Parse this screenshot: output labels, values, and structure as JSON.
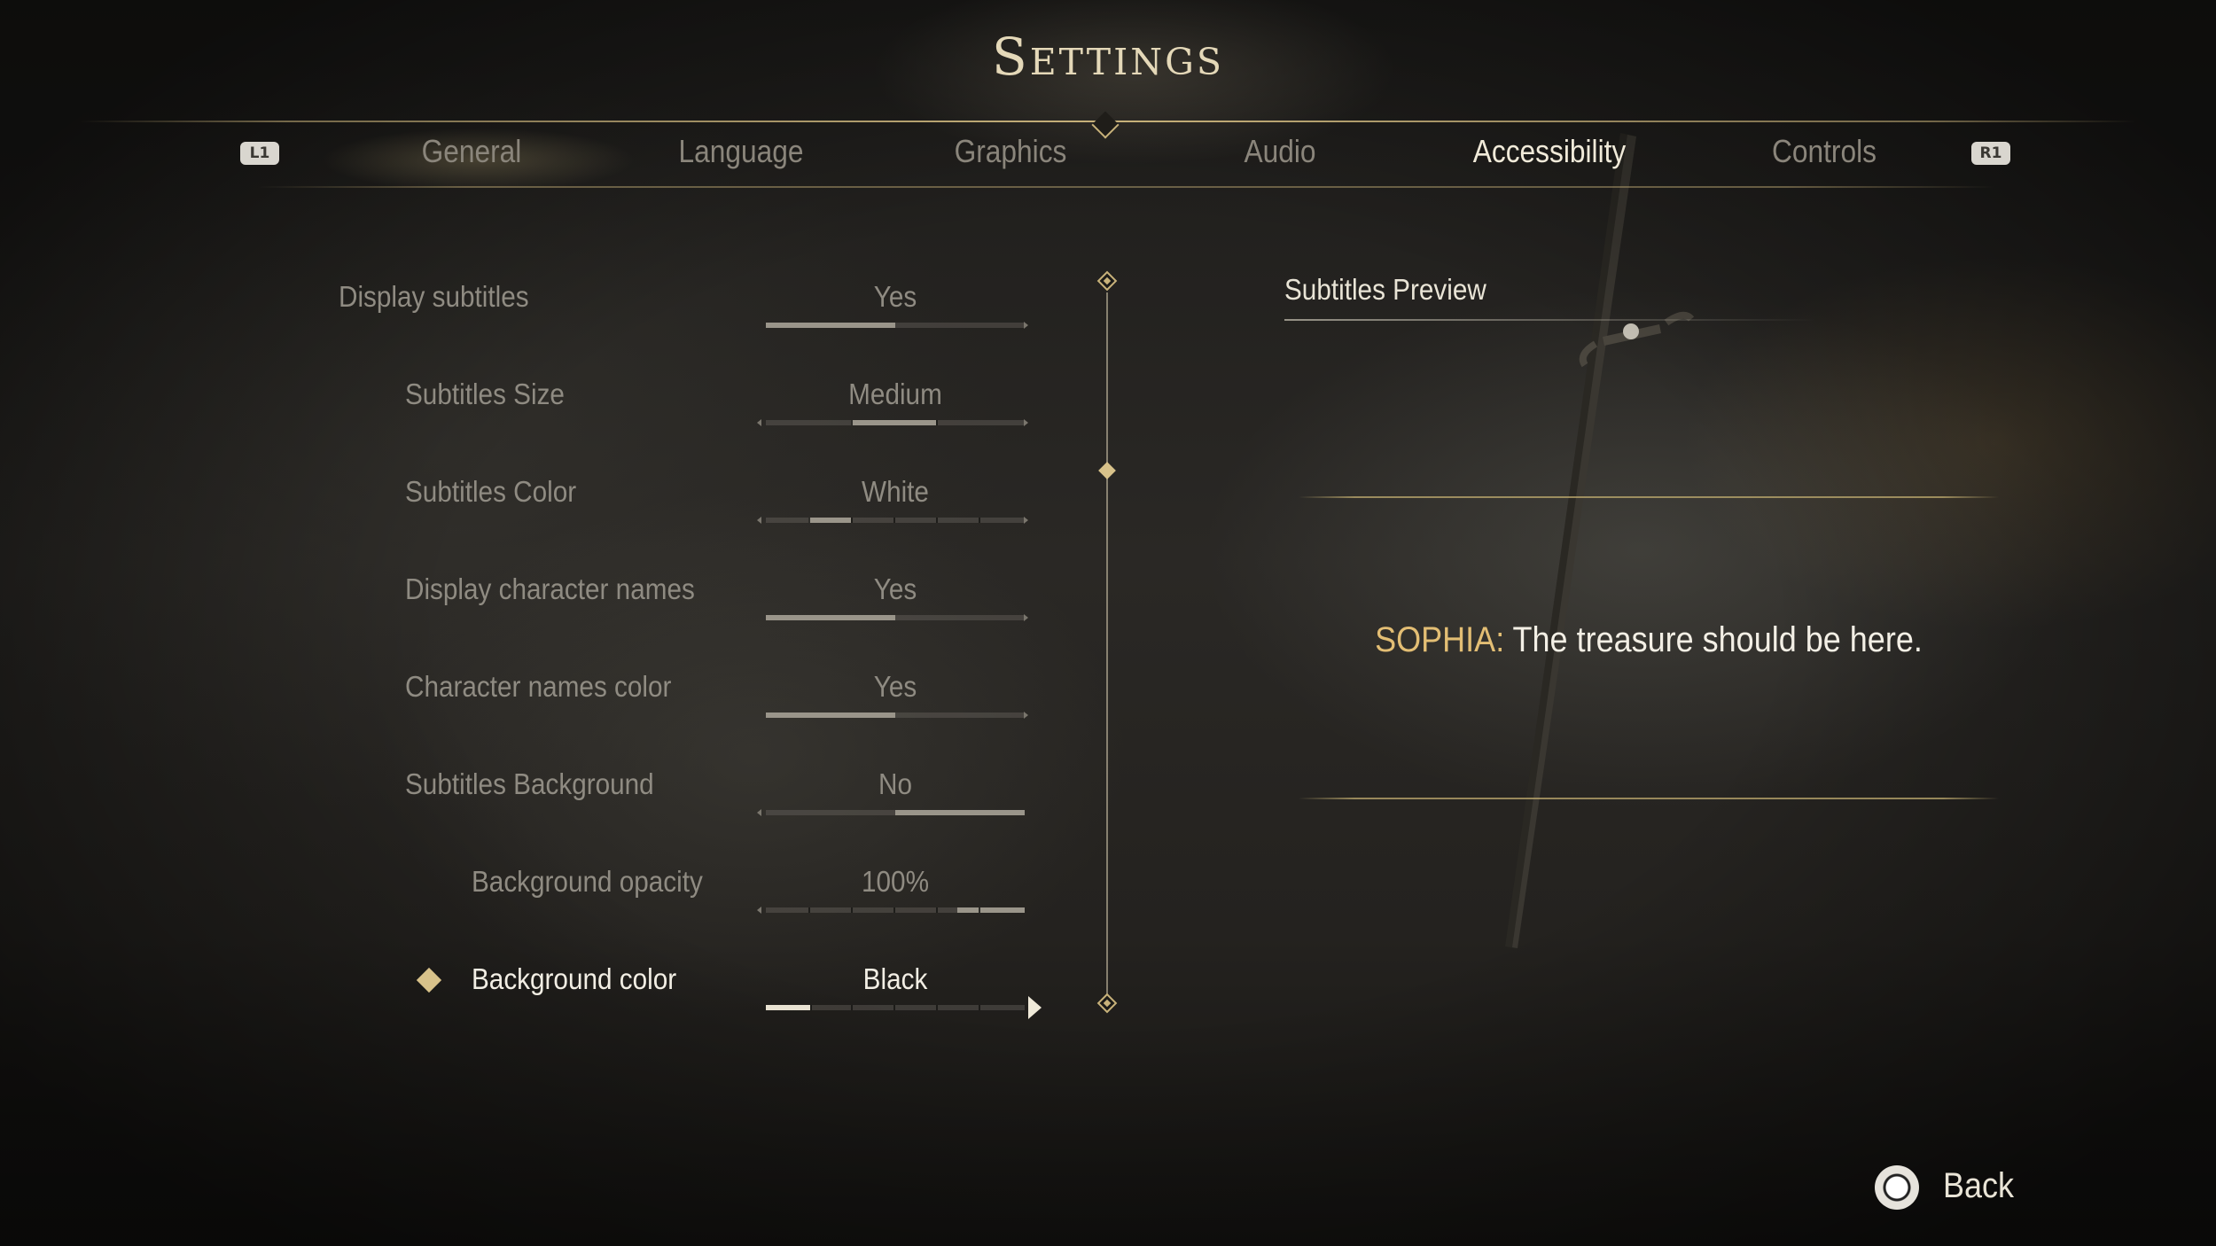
{
  "header": {
    "title": "Settings"
  },
  "tabs": [
    {
      "label": "General"
    },
    {
      "label": "Language"
    },
    {
      "label": "Graphics"
    },
    {
      "label": "Audio"
    },
    {
      "label": "Accessibility"
    },
    {
      "label": "Controls"
    }
  ],
  "active_tab": "Accessibility",
  "bumpers": {
    "left": "L1",
    "right": "R1"
  },
  "options": [
    {
      "label": "Display subtitles",
      "value": "Yes",
      "level": 0.5
    },
    {
      "label": "Subtitles Size",
      "value": "Medium",
      "level": 0.5
    },
    {
      "label": "Subtitles Color",
      "value": "White",
      "level": 0.2
    },
    {
      "label": "Display character names",
      "value": "Yes",
      "level": 0.5
    },
    {
      "label": "Character names color",
      "value": "Yes",
      "level": 0.5
    },
    {
      "label": "Subtitles Background",
      "value": "No",
      "level": 1.0
    },
    {
      "label": "Background opacity",
      "value": "100%",
      "level": 1.0
    },
    {
      "label": "Background color",
      "value": "Black",
      "level": 0.17
    }
  ],
  "selected_option": "Background color",
  "preview": {
    "title": "Subtitles Preview",
    "speaker": "SOPHIA:",
    "line": "The treasure should be here."
  },
  "footer": {
    "back_label": "Back"
  },
  "colors": {
    "accent": "#c8b27a",
    "speaker": "#e3be74",
    "text_active": "#f2eee4",
    "text_inactive": "#8f8b82"
  }
}
